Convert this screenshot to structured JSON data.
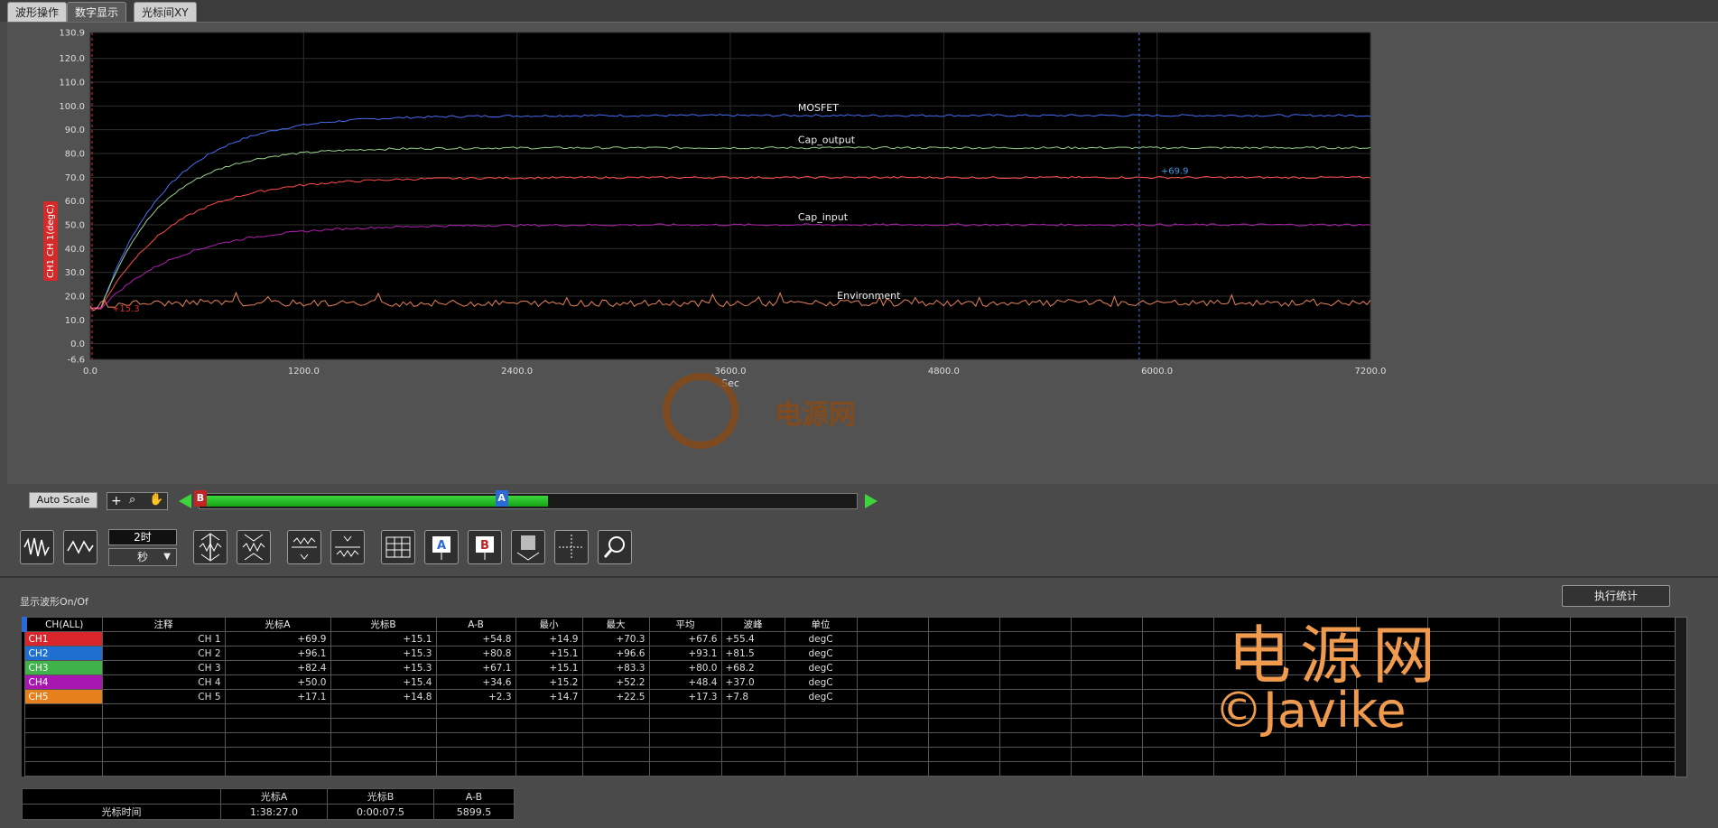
{
  "tabs": [
    "波形操作",
    "数字显示",
    "光标间XY"
  ],
  "active_tab": 1,
  "chart_data": {
    "type": "line",
    "xlabel": "Sec",
    "ylabel_badge": "CH1",
    "ylabel": "CH 1(degC)",
    "xlim": [
      0,
      7200
    ],
    "ylim": [
      -6.6,
      130.9
    ],
    "x_ticks": [
      "0.0",
      "1200.0",
      "2400.0",
      "3600.0",
      "4800.0",
      "6000.0",
      "7200.0"
    ],
    "y_ticks": [
      "130.9",
      "120.0",
      "110.0",
      "100.0",
      "90.0",
      "80.0",
      "70.0",
      "60.0",
      "50.0",
      "40.0",
      "30.0",
      "20.0",
      "10.0",
      "0.0",
      "-6.6"
    ],
    "series": [
      {
        "name": "MOSFET",
        "color": "#4a6cf0",
        "start": 15,
        "final": 96,
        "tau": 380
      },
      {
        "name": "Cap_output",
        "color": "#9bd08e",
        "start": 15,
        "final": 82.4,
        "tau": 330
      },
      {
        "name": "",
        "color": "#ff4a4a",
        "start": 15,
        "final": 69.9,
        "tau": 400
      },
      {
        "name": "Cap_input",
        "color": "#b020b0",
        "start": 15,
        "final": 50,
        "tau": 450
      },
      {
        "name": "Environment",
        "color": "#e8845a",
        "start": 15,
        "final": 17,
        "tau": 50
      }
    ],
    "cursor_a_x": 5899.5,
    "cursor_a_value": "+69.9",
    "cursor_b_value": "+15.3"
  },
  "controls": {
    "auto_scale": "Auto Scale",
    "time_value": "2时",
    "time_unit": "秒",
    "marker_b": "B",
    "marker_a": "A",
    "scroll_fill_fraction": 0.53,
    "marker_a_fraction": 0.45
  },
  "table": {
    "label": "显示波形On/Of",
    "exec_button": "执行统计",
    "headers": [
      "CH(ALL)",
      "注释",
      "光标A",
      "光标B",
      "A-B",
      "最小",
      "最大",
      "平均",
      "波峰",
      "单位"
    ],
    "rows": [
      {
        "ch": "CH1",
        "color": "#d9262c",
        "note": "CH 1",
        "a": "+69.9",
        "b": "+15.1",
        "ab": "+54.8",
        "min": "+14.9",
        "max": "+70.3",
        "avg": "+67.6",
        "peak": "+55.4",
        "unit": "degC"
      },
      {
        "ch": "CH2",
        "color": "#1f6fd0",
        "note": "CH 2",
        "a": "+96.1",
        "b": "+15.3",
        "ab": "+80.8",
        "min": "+15.1",
        "max": "+96.6",
        "avg": "+93.1",
        "peak": "+81.5",
        "unit": "degC"
      },
      {
        "ch": "CH3",
        "color": "#3fb24a",
        "note": "CH 3",
        "a": "+82.4",
        "b": "+15.3",
        "ab": "+67.1",
        "min": "+15.1",
        "max": "+83.3",
        "avg": "+80.0",
        "peak": "+68.2",
        "unit": "degC"
      },
      {
        "ch": "CH4",
        "color": "#a818b0",
        "note": "CH 4",
        "a": "+50.0",
        "b": "+15.4",
        "ab": "+34.6",
        "min": "+15.2",
        "max": "+52.2",
        "avg": "+48.4",
        "peak": "+37.0",
        "unit": "degC"
      },
      {
        "ch": "CH5",
        "color": "#e5801c",
        "note": "CH 5",
        "a": "+17.1",
        "b": "+14.8",
        "ab": "+2.3",
        "min": "+14.7",
        "max": "+22.5",
        "avg": "+17.3",
        "peak": "+7.8",
        "unit": "degC"
      }
    ]
  },
  "cursor_table": {
    "headers": [
      "光标A",
      "光标B",
      "A-B"
    ],
    "row_label": "光标时间",
    "values": [
      "1:38:27.0",
      "0:00:07.5",
      "5899.5"
    ]
  },
  "watermark": {
    "line1": "电源网",
    "line2": "©Javike",
    "logo_text": "电源网"
  }
}
